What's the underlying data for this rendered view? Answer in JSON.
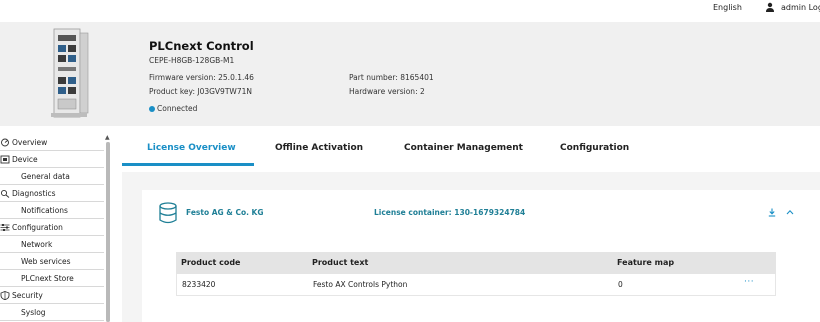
{
  "topbar": {
    "language": "English",
    "user_label": "admin Log"
  },
  "device": {
    "title": "PLCnext Control",
    "model": "CEPE-H8GB-128GB-M1",
    "firmware": "Firmware version: 25.0.1.46",
    "product_key": "Product key: J03GV9TW71N",
    "part_number": "Part number: 8165401",
    "hardware_version": "Hardware version: 2",
    "status": "Connected",
    "status_color": "#1a8fc6"
  },
  "sidebar": {
    "items": [
      {
        "label": "Overview",
        "level": "top",
        "icon": "overview-icon"
      },
      {
        "label": "Device",
        "level": "top",
        "icon": "device-icon"
      },
      {
        "label": "General data",
        "level": "sub"
      },
      {
        "label": "Diagnostics",
        "level": "top",
        "icon": "diagnostics-icon"
      },
      {
        "label": "Notifications",
        "level": "sub"
      },
      {
        "label": "Configuration",
        "level": "top",
        "icon": "configuration-icon"
      },
      {
        "label": "Network",
        "level": "sub"
      },
      {
        "label": "Web services",
        "level": "sub"
      },
      {
        "label": "PLCnext Store",
        "level": "sub"
      },
      {
        "label": "Security",
        "level": "top",
        "icon": "shield-icon"
      },
      {
        "label": "Syslog",
        "level": "sub"
      }
    ]
  },
  "tabs": [
    {
      "label": "License Overview",
      "active": true
    },
    {
      "label": "Offline Activation",
      "active": false
    },
    {
      "label": "Container Management",
      "active": false
    },
    {
      "label": "Configuration",
      "active": false
    }
  ],
  "license": {
    "company": "Festo AG & Co. KG",
    "container": "License container: 130-1679324784",
    "table": {
      "headers": [
        "Product code",
        "Product text",
        "Feature map"
      ],
      "rows": [
        {
          "product_code": "8233420",
          "product_text": "Festo AX Controls Python",
          "feature_map": "0",
          "more": "···"
        }
      ]
    }
  },
  "colors": {
    "accent": "#1a8fc6",
    "teal_text": "#1f7f96",
    "header_bg": "#f0f0f0"
  }
}
